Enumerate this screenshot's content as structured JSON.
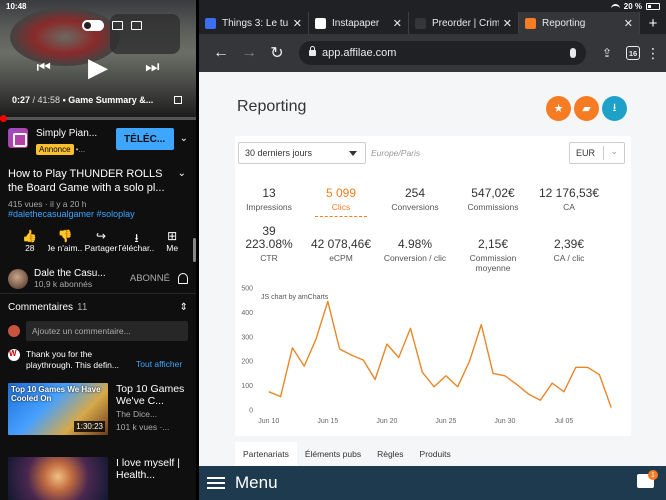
{
  "left": {
    "status_time": "10:48",
    "player": {
      "time_current": "0:27",
      "time_total": "/ 41:58",
      "chapter": "• Game Summary &...",
      "progress_fraction": 0.011
    },
    "ad": {
      "name": "Simply Pian...",
      "badge": "Annonce",
      "dots": "•...",
      "button": "TÉLÉC..."
    },
    "video": {
      "title": "How to Play THUNDER ROLLS the Board Game with a solo pl...",
      "meta": "415 vues · il y a 20 h",
      "tags": "#dalethecasualgamer #soloplay"
    },
    "actions": [
      {
        "glyph": "👍",
        "label": "28"
      },
      {
        "glyph": "👎",
        "label": "Je n'aim..."
      },
      {
        "glyph": "↪",
        "label": "Partager"
      },
      {
        "glyph": "⭳",
        "label": "Téléchar..."
      },
      {
        "glyph": "⊞",
        "label": "Me"
      }
    ],
    "channel": {
      "name": "Dale the Casu...",
      "subs": "10,9 k abonnés",
      "subscribed": "ABONNÉ"
    },
    "comments": {
      "header": "Commentaires",
      "count": "11",
      "placeholder": "Ajoutez un commentaire...",
      "top_comment": "Thank you for the playthrough. This defin...",
      "show_all": "Tout afficher"
    },
    "recs": [
      {
        "thumb_caption": "Top 10 Games We Have Cooled On",
        "duration": "1:30:23",
        "title": "Top 10 Games We've C...",
        "channel": "The Dice...",
        "views": "101 k vues ·..."
      },
      {
        "thumb_caption": "",
        "duration": "",
        "title": "I love myself | Health...",
        "channel": "",
        "views": ""
      }
    ]
  },
  "right": {
    "status_battery": "20 %",
    "tabs": [
      {
        "label": "Things 3: Le tu",
        "fav_color": "#3d6df2"
      },
      {
        "label": "Instapaper",
        "fav_color": "#ffffff"
      },
      {
        "label": "Preorder | Crim",
        "fav_color": "#35363a"
      },
      {
        "label": "Reporting",
        "fav_color": "#f57c22"
      }
    ],
    "url": "app.affilae.com",
    "tab_count": "16",
    "page": {
      "title": "Reporting",
      "period": "30 derniers jours",
      "timezone": "Europe/Paris",
      "currency": "EUR",
      "stats_row1": [
        {
          "value": "13",
          "label": "Impressions"
        },
        {
          "value": "5 099",
          "label": "Clics"
        },
        {
          "value": "254",
          "label": "Conversions"
        },
        {
          "value": "547,02€",
          "label": "Commissions"
        },
        {
          "value": "12 176,53€",
          "label": "CA"
        }
      ],
      "stats_row2": [
        {
          "value": "39",
          "label": ""
        },
        {
          "value": "223.08%",
          "label": "CTR"
        },
        {
          "value": "42 078,46€",
          "label": "eCPM"
        },
        {
          "value": "4.98%",
          "label": "Conversion / clic"
        },
        {
          "value": "2,15€",
          "label": "Commission moyenne"
        },
        {
          "value": "2,39€",
          "label": "CA / clic"
        }
      ],
      "chart_credit": "JS chart by amCharts",
      "bottom_tabs": [
        "Partenariats",
        "Éléments pubs",
        "Règles",
        "Produits"
      ]
    },
    "menu_label": "Menu",
    "chat_badge": "1"
  },
  "chart_data": {
    "type": "line",
    "title": "",
    "xlabel": "",
    "ylabel": "",
    "ylim": [
      0,
      500
    ],
    "yticks": [
      0,
      100,
      200,
      300,
      400,
      500
    ],
    "x_tick_labels": [
      "Jun 10",
      "Jun 15",
      "Jun 20",
      "Jun 25",
      "Jun 30",
      "Jul 05"
    ],
    "x_tick_days": [
      0,
      5,
      10,
      15,
      20,
      25
    ],
    "x_range_days": [
      -1,
      30
    ],
    "color": "#e8872a",
    "grid": false,
    "series": [
      {
        "name": "",
        "x_days": [
          0,
          1,
          2,
          3,
          4,
          5,
          6,
          7,
          8,
          9,
          10,
          11,
          12,
          13,
          14,
          15,
          16,
          17,
          18,
          19,
          20,
          21,
          22,
          23,
          24,
          25,
          26,
          27,
          28,
          29
        ],
        "values": [
          75,
          55,
          255,
          180,
          290,
          445,
          250,
          225,
          205,
          125,
          270,
          215,
          335,
          155,
          95,
          140,
          95,
          200,
          350,
          150,
          140,
          105,
          65,
          40,
          110,
          75,
          175,
          175,
          145,
          10
        ]
      }
    ]
  }
}
